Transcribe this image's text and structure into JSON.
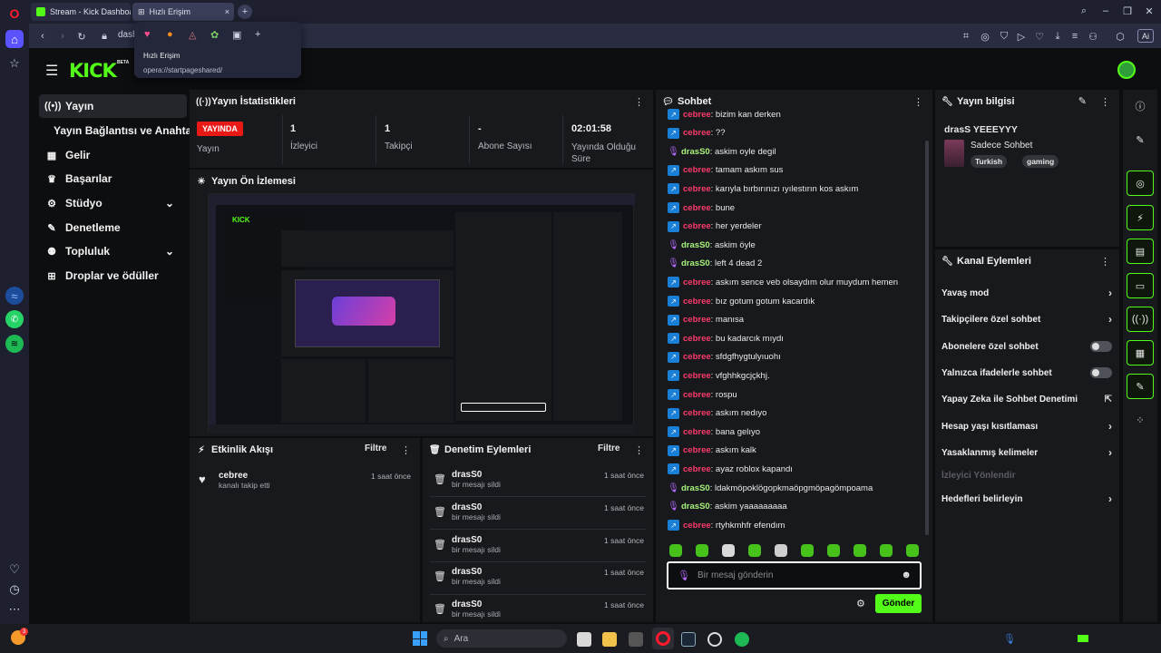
{
  "browser": {
    "tabs": [
      {
        "label": "Stream - Kick Dashboard"
      },
      {
        "label": "Hızlı Erişim"
      }
    ],
    "address": "dash",
    "ai_label": "Ai",
    "popup": {
      "title": "Hızlı Erişim",
      "url": "opera://startpageshared/"
    }
  },
  "header": {
    "logo": "KICK",
    "beta": "BETA"
  },
  "nav": [
    {
      "label": "Yayın"
    },
    {
      "label": "Yayın Bağlantısı ve Anahtarı"
    },
    {
      "label": "Gelir"
    },
    {
      "label": "Başarılar"
    },
    {
      "label": "Stüdyo"
    },
    {
      "label": "Denetleme"
    },
    {
      "label": "Topluluk"
    },
    {
      "label": "Droplar ve ödüller"
    }
  ],
  "stats": {
    "title": "Yayın İstatistikleri",
    "live_badge": "YAYINDA",
    "items": [
      {
        "value": "",
        "label": "Yayın"
      },
      {
        "value": "1",
        "label": "İzleyici"
      },
      {
        "value": "1",
        "label": "Takipçi"
      },
      {
        "value": "-",
        "label": "Abone Sayısı"
      },
      {
        "value": "02:01:58",
        "label": "Yayında Olduğu Süre"
      }
    ]
  },
  "preview": {
    "title": "Yayın Ön İzlemesi"
  },
  "activity": {
    "title": "Etkinlik Akışı",
    "filter": "Filtre",
    "items": [
      {
        "name": "cebree",
        "sub": "kanalı takip etti",
        "time": "1 saat önce"
      }
    ]
  },
  "moderation": {
    "title": "Denetim Eylemleri",
    "filter": "Filtre",
    "items": [
      {
        "name": "drasS0",
        "sub": "bir mesajı sildi",
        "time": "1 saat önce"
      },
      {
        "name": "drasS0",
        "sub": "bir mesajı sildi",
        "time": "1 saat önce"
      },
      {
        "name": "drasS0",
        "sub": "bir mesajı sildi",
        "time": "1 saat önce"
      },
      {
        "name": "drasS0",
        "sub": "bir mesajı sildi",
        "time": "1 saat önce"
      },
      {
        "name": "drasS0",
        "sub": "bir mesajı sildi",
        "time": "1 saat önce"
      }
    ]
  },
  "chat": {
    "title": "Sohbet",
    "messages": [
      {
        "user": "cebree",
        "text": ": bizim kan derken"
      },
      {
        "user": "cebree",
        "text": ": ??"
      },
      {
        "user": "drasS0",
        "text": ": askim oyle degil"
      },
      {
        "user": "cebree",
        "text": ": tamam askım sus"
      },
      {
        "user": "cebree",
        "text": ": karıyla bırbırınızı ıyılestırın kos askım"
      },
      {
        "user": "cebree",
        "text": ": bune"
      },
      {
        "user": "cebree",
        "text": ": her yerdeler"
      },
      {
        "user": "drasS0",
        "text": ": askim öyle"
      },
      {
        "user": "drasS0",
        "text": ": left 4 dead 2"
      },
      {
        "user": "cebree",
        "text": ": askım sence veb olsaydım olur muydum hemen"
      },
      {
        "user": "cebree",
        "text": ": bız gotum gotum kacardık"
      },
      {
        "user": "cebree",
        "text": ": manısa"
      },
      {
        "user": "cebree",
        "text": ": bu kadarcık mıydı"
      },
      {
        "user": "cebree",
        "text": ": sfdgfhygtulyıuohı"
      },
      {
        "user": "cebree",
        "text": ": vfghhkgcjçkhj."
      },
      {
        "user": "cebree",
        "text": ": rospu"
      },
      {
        "user": "cebree",
        "text": ": askım nedıyo"
      },
      {
        "user": "cebree",
        "text": ": bana gelıyo"
      },
      {
        "user": "cebree",
        "text": ": askım kalk"
      },
      {
        "user": "cebree",
        "text": ": ayaz roblox kapandı"
      },
      {
        "user": "drasS0",
        "text": ": ldakmöpoklögopkmaöpgmöpagömpoama"
      },
      {
        "user": "drasS0",
        "text": ": askim yaaaaaaaaa"
      },
      {
        "user": "cebree",
        "text": ": rtyhkmhfr efendım"
      }
    ],
    "input_placeholder": "Bir mesaj gönderin",
    "send": "Gönder"
  },
  "stream_info": {
    "title": "Yayın bilgisi",
    "stream_title": "drasS YEEEYYY",
    "category": "Sadece Sohbet",
    "tags": [
      "Turkish",
      "gaming"
    ]
  },
  "channel_actions": {
    "title": "Kanal Eylemleri",
    "items": [
      {
        "label": "Yavaş mod",
        "kind": "arrow"
      },
      {
        "label": "Takipçilere özel sohbet",
        "kind": "arrow"
      },
      {
        "label": "Abonelere özel sohbet",
        "kind": "toggle"
      },
      {
        "label": "Yalnızca ifadelerle sohbet",
        "kind": "toggle"
      },
      {
        "label": "Yapay Zeka ile Sohbet Denetimi",
        "kind": "external"
      },
      {
        "label": "Hesap yaşı kısıtlaması",
        "kind": "arrow"
      },
      {
        "label": "Yasaklanmış kelimeler",
        "kind": "arrow"
      },
      {
        "label": "İzleyici Yönlendir",
        "kind": "disabled"
      },
      {
        "label": "Hedefleri belirleyin",
        "kind": "arrow"
      }
    ]
  },
  "taskbar": {
    "search": "Ara",
    "badge": "3"
  },
  "colors": {
    "accent": "#53fc18",
    "live": "#e91916",
    "panel": "#18191d"
  }
}
